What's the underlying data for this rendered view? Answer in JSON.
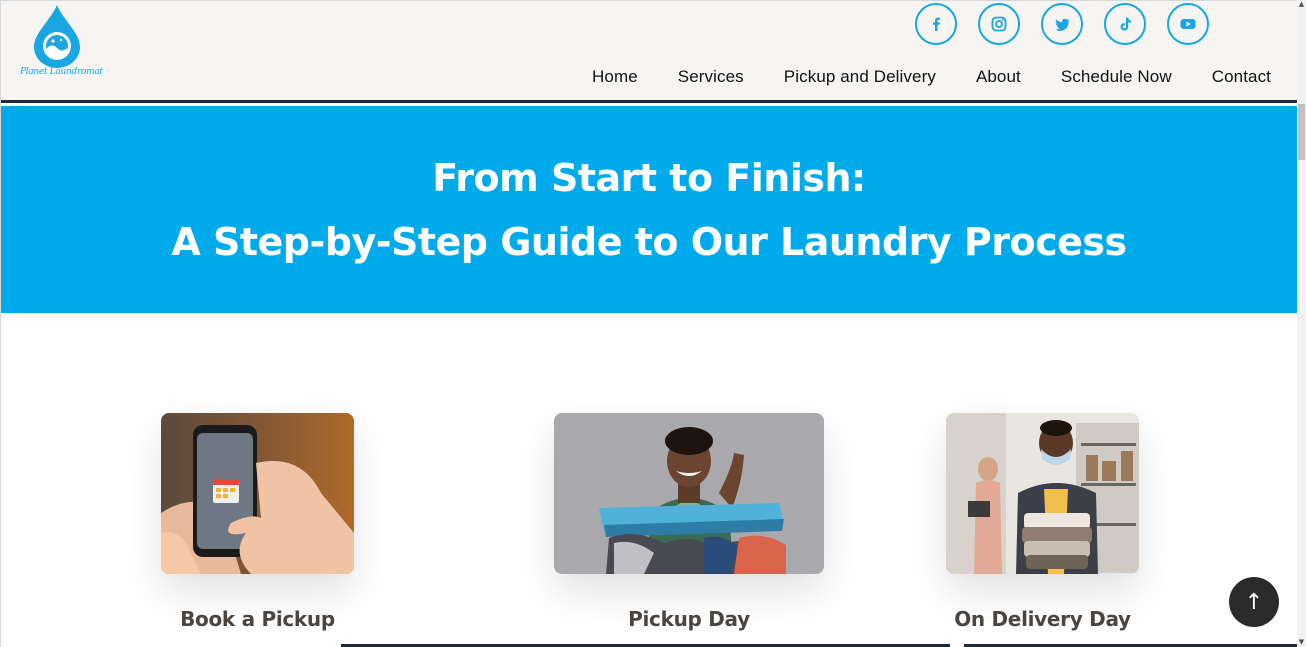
{
  "brand": {
    "name": "Planet Laundromat",
    "color": "#1aa6e0"
  },
  "socials": [
    {
      "name": "facebook"
    },
    {
      "name": "instagram"
    },
    {
      "name": "twitter"
    },
    {
      "name": "tiktok"
    },
    {
      "name": "youtube"
    }
  ],
  "nav": {
    "items": [
      "Home",
      "Services",
      "Pickup and Delivery",
      "About",
      "Schedule Now",
      "Contact"
    ]
  },
  "hero": {
    "line1": "From Start to Finish:",
    "line2": "A Step-by-Step Guide to Our Laundry Process",
    "background": "#00aaeb"
  },
  "steps": [
    {
      "title": "Book a Pickup"
    },
    {
      "title": "Pickup Day"
    },
    {
      "title": "On Delivery Day"
    }
  ],
  "scroll_top": {
    "label": "↑"
  }
}
